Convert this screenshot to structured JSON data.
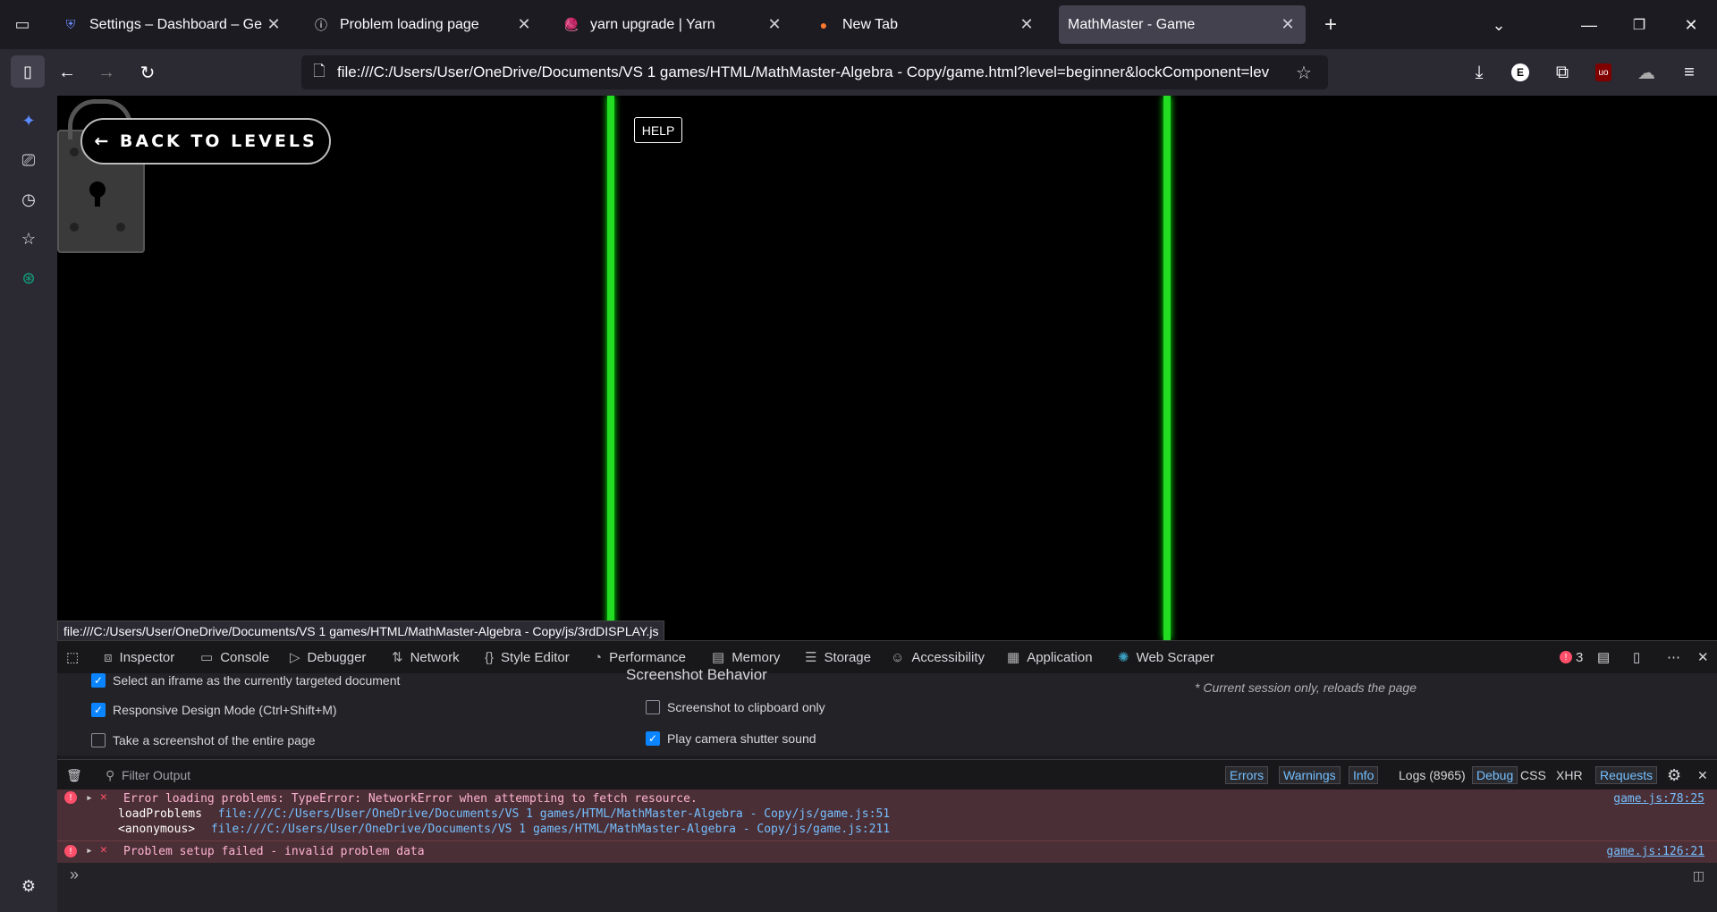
{
  "tabs": [
    {
      "label": "Settings – Dashboard – Gemini",
      "icon": "shield-icon",
      "active": false
    },
    {
      "label": "Problem loading page",
      "icon": "info-icon",
      "active": false
    },
    {
      "label": "yarn upgrade | Yarn",
      "icon": "yarn-icon",
      "active": false
    },
    {
      "label": "New Tab",
      "icon": "firefox-icon",
      "active": false
    },
    {
      "label": "MathMaster - Game",
      "icon": "",
      "active": true
    }
  ],
  "url": "file:///C:/Users/User/OneDrive/Documents/VS 1 games/HTML/MathMaster-Algebra - Copy/game.html?level=beginner&lockComponent=lev",
  "game": {
    "back_label": "← BACK TO LEVELS",
    "help_label": "HELP"
  },
  "status_url": "file:///C:/Users/User/OneDrive/Documents/VS 1 games/HTML/MathMaster-Algebra - Copy/js/3rdDISPLAY.js",
  "devtools": {
    "tabs": [
      {
        "label": "Inspector",
        "icon": "inspector-icon"
      },
      {
        "label": "Console",
        "icon": "console-icon"
      },
      {
        "label": "Debugger",
        "icon": "debugger-icon"
      },
      {
        "label": "Network",
        "icon": "network-icon"
      },
      {
        "label": "Style Editor",
        "icon": "style-editor-icon"
      },
      {
        "label": "Performance",
        "icon": "performance-icon"
      },
      {
        "label": "Memory",
        "icon": "memory-icon"
      },
      {
        "label": "Storage",
        "icon": "storage-icon"
      },
      {
        "label": "Accessibility",
        "icon": "accessibility-icon"
      },
      {
        "label": "Application",
        "icon": "application-icon"
      },
      {
        "label": "Web Scraper",
        "icon": "web-scraper-icon"
      }
    ],
    "error_count": "3",
    "settings": {
      "opt_iframe": "Select an iframe as the currently targeted document",
      "opt_responsive": "Responsive Design Mode (Ctrl+Shift+M)",
      "opt_screenshot_page": "Take a screenshot of the entire page",
      "screenshot_heading": "Screenshot Behavior",
      "opt_clipboard": "Screenshot to clipboard only",
      "opt_shutter": "Play camera shutter sound",
      "session_note": "* Current session only, reloads the page"
    },
    "console": {
      "filter_placeholder": "Filter Output",
      "filters": [
        "Errors",
        "Warnings",
        "Info",
        "Logs (8965)",
        "Debug",
        "CSS",
        "XHR",
        "Requests"
      ],
      "messages": [
        {
          "text": "Error loading problems: TypeError: NetworkError when attempting to fetch resource.",
          "location": "game.js:78:25",
          "trace": [
            {
              "fn": "loadProblems",
              "src": "file:///C:/Users/User/OneDrive/Documents/VS 1 games/HTML/MathMaster-Algebra - Copy/js/game.js:51"
            },
            {
              "fn": "<anonymous>",
              "src": "file:///C:/Users/User/OneDrive/Documents/VS 1 games/HTML/MathMaster-Algebra - Copy/js/game.js:211"
            }
          ]
        },
        {
          "text": "Problem setup failed - invalid problem data",
          "location": "game.js:126:21",
          "trace": []
        }
      ],
      "prompt": "»"
    }
  }
}
